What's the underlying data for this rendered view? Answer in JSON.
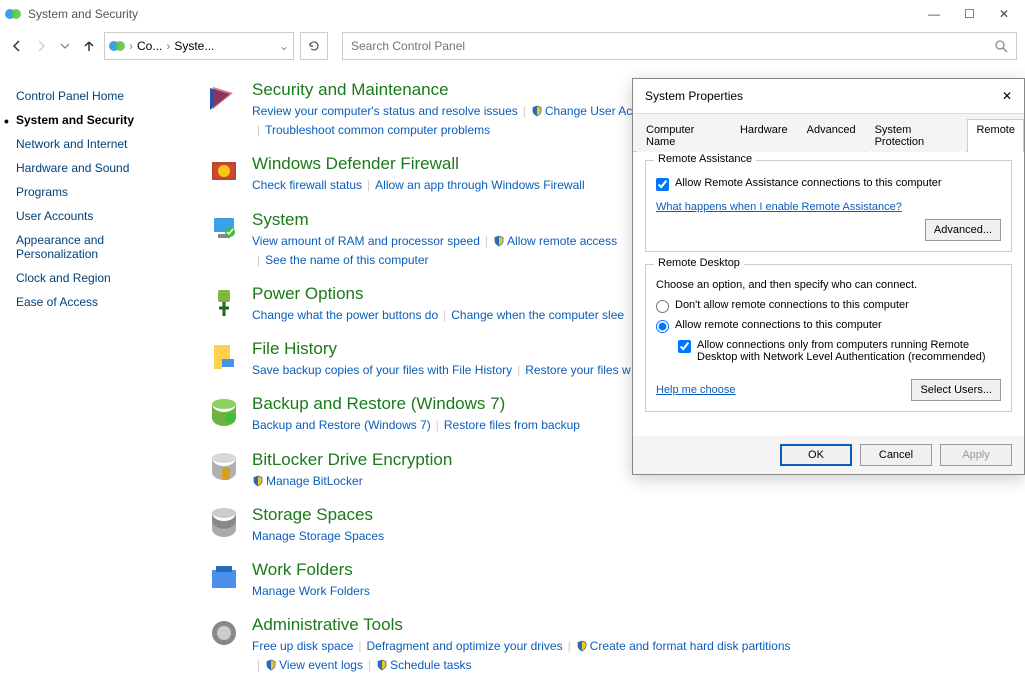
{
  "window": {
    "title": "System and Security"
  },
  "toolbar": {
    "breadcrumb": {
      "root": "Co...",
      "current": "Syste..."
    },
    "search_placeholder": "Search Control Panel"
  },
  "sidebar": {
    "items": [
      {
        "label": "Control Panel Home",
        "active": false
      },
      {
        "label": "System and Security",
        "active": true
      },
      {
        "label": "Network and Internet",
        "active": false
      },
      {
        "label": "Hardware and Sound",
        "active": false
      },
      {
        "label": "Programs",
        "active": false
      },
      {
        "label": "User Accounts",
        "active": false
      },
      {
        "label": "Appearance and Personalization",
        "active": false
      },
      {
        "label": "Clock and Region",
        "active": false
      },
      {
        "label": "Ease of Access",
        "active": false
      }
    ]
  },
  "categories": [
    {
      "title": "Security and Maintenance",
      "links": [
        {
          "text": "Review your computer's status and resolve issues"
        },
        {
          "text": "Change User Ac",
          "shield": true
        },
        {
          "text": "Troubleshoot common computer problems"
        }
      ]
    },
    {
      "title": "Windows Defender Firewall",
      "links": [
        {
          "text": "Check firewall status"
        },
        {
          "text": "Allow an app through Windows Firewall"
        }
      ]
    },
    {
      "title": "System",
      "links": [
        {
          "text": "View amount of RAM and processor speed"
        },
        {
          "text": "Allow remote access",
          "shield": true
        },
        {
          "text": "See the name of this computer"
        }
      ]
    },
    {
      "title": "Power Options",
      "links": [
        {
          "text": "Change what the power buttons do"
        },
        {
          "text": "Change when the computer slee"
        }
      ]
    },
    {
      "title": "File History",
      "links": [
        {
          "text": "Save backup copies of your files with File History"
        },
        {
          "text": "Restore your files w"
        }
      ]
    },
    {
      "title": "Backup and Restore (Windows 7)",
      "links": [
        {
          "text": "Backup and Restore (Windows 7)"
        },
        {
          "text": "Restore files from backup"
        }
      ]
    },
    {
      "title": "BitLocker Drive Encryption",
      "links": [
        {
          "text": "Manage BitLocker",
          "shield": true
        }
      ]
    },
    {
      "title": "Storage Spaces",
      "links": [
        {
          "text": "Manage Storage Spaces"
        }
      ]
    },
    {
      "title": "Work Folders",
      "links": [
        {
          "text": "Manage Work Folders"
        }
      ]
    },
    {
      "title": "Administrative Tools",
      "links": [
        {
          "text": "Free up disk space"
        },
        {
          "text": "Defragment and optimize your drives"
        },
        {
          "text": "Create and format hard disk partitions",
          "shield": true
        },
        {
          "text": "View event logs",
          "shield": true
        },
        {
          "text": "Schedule tasks",
          "shield": true
        }
      ]
    }
  ],
  "dialog": {
    "title": "System Properties",
    "tabs": [
      "Computer Name",
      "Hardware",
      "Advanced",
      "System Protection",
      "Remote"
    ],
    "active_tab": 4,
    "ra": {
      "group": "Remote Assistance",
      "allow_label": "Allow Remote Assistance connections to this computer",
      "help_link": "What happens when I enable Remote Assistance?",
      "advanced_btn": "Advanced..."
    },
    "rd": {
      "group": "Remote Desktop",
      "desc": "Choose an option, and then specify who can connect.",
      "opt_deny": "Don't allow remote connections to this computer",
      "opt_allow": "Allow remote connections to this computer",
      "nla": "Allow connections only from computers running Remote Desktop with Network Level Authentication (recommended)",
      "help": "Help me choose",
      "select_btn": "Select Users..."
    },
    "buttons": {
      "ok": "OK",
      "cancel": "Cancel",
      "apply": "Apply"
    }
  }
}
